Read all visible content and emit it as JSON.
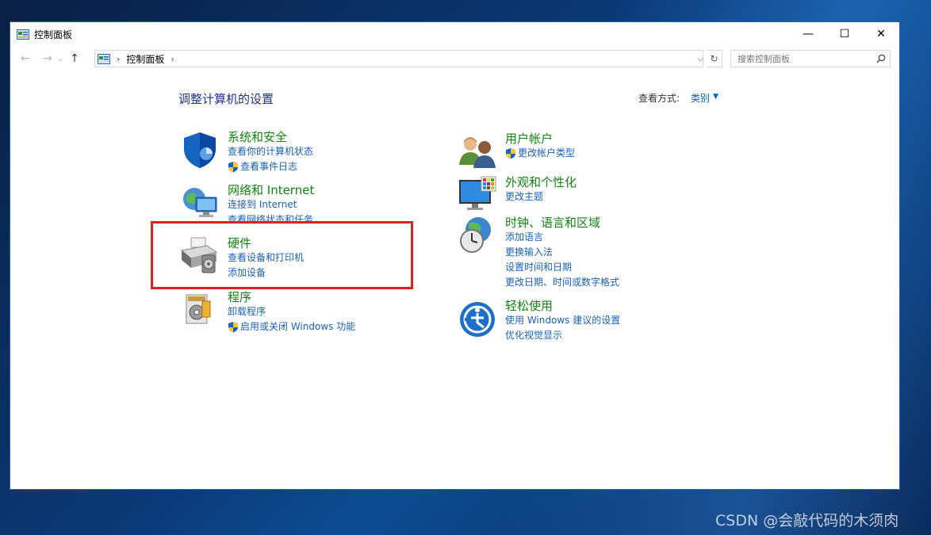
{
  "window": {
    "title": "控制面板",
    "controls": {
      "minimize": "—",
      "maximize": "☐",
      "close": "✕"
    }
  },
  "nav": {
    "back": "←",
    "forward": "→",
    "recent": "⌄",
    "up": "↑",
    "breadcrumb": [
      "控制面板"
    ],
    "refresh": "↻",
    "dropdown": "⌵"
  },
  "search": {
    "placeholder": "搜索控制面板"
  },
  "main": {
    "title": "调整计算机的设置",
    "view_by_label": "查看方式:",
    "view_by_mode": "类别"
  },
  "left_categories": [
    {
      "title": "系统和安全",
      "icon": "shield-icon",
      "links": [
        {
          "text": "查看你的计算机状态",
          "shield": false
        },
        {
          "text": "查看事件日志",
          "shield": true
        }
      ]
    },
    {
      "title": "网络和 Internet",
      "icon": "network-icon",
      "links": [
        {
          "text": "连接到 Internet",
          "shield": false
        },
        {
          "text": "查看网络状态和任务",
          "shield": false
        }
      ]
    },
    {
      "title": "硬件",
      "icon": "printer-icon",
      "links": [
        {
          "text": "查看设备和打印机",
          "shield": false
        },
        {
          "text": "添加设备",
          "shield": false
        }
      ]
    },
    {
      "title": "程序",
      "icon": "programs-icon",
      "links": [
        {
          "text": "卸载程序",
          "shield": false
        },
        {
          "text": "启用或关闭 Windows 功能",
          "shield": true
        }
      ]
    }
  ],
  "right_categories": [
    {
      "title": "用户帐户",
      "icon": "users-icon",
      "links": [
        {
          "text": "更改帐户类型",
          "shield": true
        }
      ]
    },
    {
      "title": "外观和个性化",
      "icon": "monitor-icon",
      "links": [
        {
          "text": "更改主题",
          "shield": false
        }
      ]
    },
    {
      "title": "时钟、语言和区域",
      "icon": "clock-globe-icon",
      "links": [
        {
          "text": "添加语言",
          "shield": false
        },
        {
          "text": "更换输入法",
          "shield": false
        },
        {
          "text": "设置时间和日期",
          "shield": false
        },
        {
          "text": "更改日期、时间或数字格式",
          "shield": false
        }
      ]
    },
    {
      "title": "轻松使用",
      "icon": "ease-of-access-icon",
      "links": [
        {
          "text": "使用 Windows 建议的设置",
          "shield": false
        },
        {
          "text": "优化视觉显示",
          "shield": false
        }
      ]
    }
  ],
  "watermark": "CSDN @会敲代码的木须肉",
  "colors": {
    "category_title": "#128312",
    "link": "#1a62b8",
    "page_title": "#1e3287",
    "highlight": "#e02020"
  }
}
